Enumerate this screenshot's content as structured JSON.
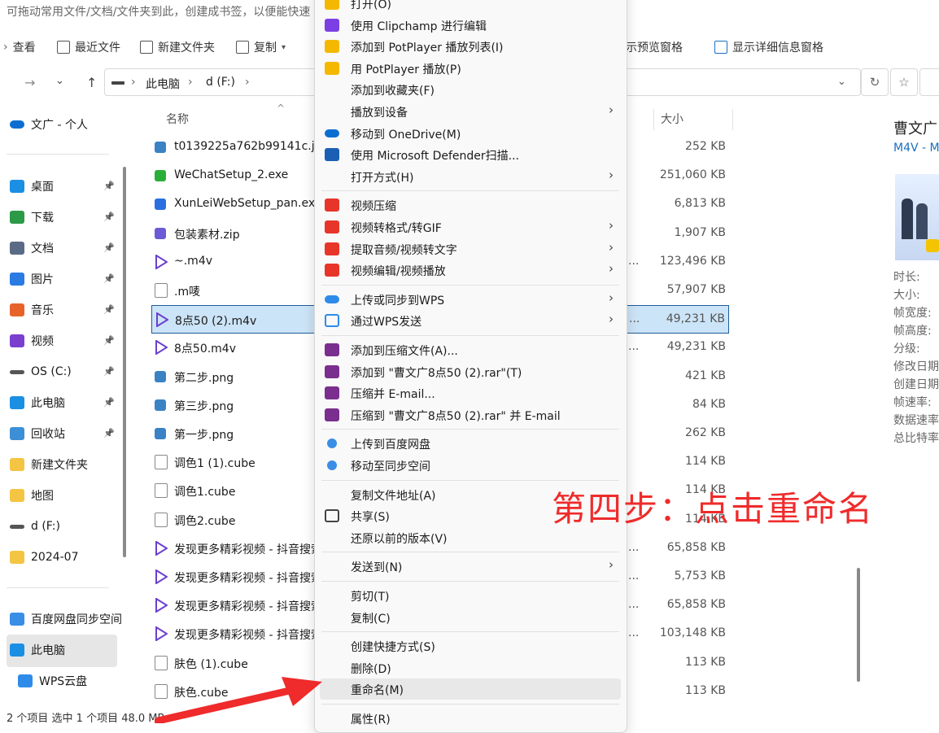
{
  "hint_text": "可拖动常用文件/文档/文件夹到此，创建成书签，以便能快速",
  "toolbar": {
    "view": "查看",
    "recent": "最近文件",
    "new_folder": "新建文件夹",
    "copy": "复制",
    "preview_pane": "示预览窗格",
    "details_pane": "显示详细信息窗格"
  },
  "address": {
    "crumbs": [
      "此电脑",
      "d (F:)"
    ]
  },
  "sidebar": {
    "account": "文广 - 个人",
    "items": [
      {
        "label": "桌面",
        "icon": "desktop-icon",
        "pinned": true
      },
      {
        "label": "下载",
        "icon": "download-icon",
        "pinned": true
      },
      {
        "label": "文档",
        "icon": "document-icon",
        "pinned": true
      },
      {
        "label": "图片",
        "icon": "pictures-icon",
        "pinned": true
      },
      {
        "label": "音乐",
        "icon": "music-icon",
        "pinned": true
      },
      {
        "label": "视频",
        "icon": "video-icon",
        "pinned": true
      },
      {
        "label": "OS (C:)",
        "icon": "drive-icon",
        "pinned": true
      },
      {
        "label": "此电脑",
        "icon": "computer-icon",
        "pinned": true
      },
      {
        "label": "回收站",
        "icon": "recycle-bin-icon",
        "pinned": true
      },
      {
        "label": "新建文件夹",
        "icon": "folder-icon",
        "pinned": false
      },
      {
        "label": "地图",
        "icon": "folder-icon",
        "pinned": false
      },
      {
        "label": "d (F:)",
        "icon": "drive-icon",
        "pinned": false
      },
      {
        "label": "2024-07",
        "icon": "folder-icon",
        "pinned": false
      }
    ],
    "bottom": [
      {
        "label": "百度网盘同步空间",
        "icon": "baidu-sync-icon"
      },
      {
        "label": "此电脑",
        "icon": "computer-icon"
      },
      {
        "label": "WPS云盘",
        "icon": "wps-cloud-icon"
      }
    ]
  },
  "columns": {
    "name": "名称",
    "size": "大小"
  },
  "files": [
    {
      "name": "t0139225a762b99141c.jpg",
      "size": "252 KB",
      "dots": false,
      "selected": false,
      "icon": "image-file-icon"
    },
    {
      "name": "WeChatSetup_2.exe",
      "size": "251,060 KB",
      "dots": false,
      "selected": false,
      "icon": "wechat-icon"
    },
    {
      "name": "XunLeiWebSetup_pan.exe",
      "size": "6,813 KB",
      "dots": false,
      "selected": false,
      "icon": "xunlei-icon"
    },
    {
      "name": "包装素材.zip",
      "size": "1,907 KB",
      "dots": false,
      "selected": false,
      "icon": "zip-file-icon"
    },
    {
      "name": "~.m4v",
      "size": "123,496 KB",
      "dots": true,
      "selected": false,
      "icon": "video-file-icon"
    },
    {
      "name": ".m唛",
      "size": "57,907 KB",
      "dots": false,
      "selected": false,
      "icon": "generic-file-icon"
    },
    {
      "name": "8点50 (2).m4v",
      "size": "49,231 KB",
      "dots": true,
      "selected": true,
      "icon": "video-file-icon"
    },
    {
      "name": "8点50.m4v",
      "size": "49,231 KB",
      "dots": true,
      "selected": false,
      "icon": "video-file-icon"
    },
    {
      "name": "第二步.png",
      "size": "421 KB",
      "dots": false,
      "selected": false,
      "icon": "image-file-icon"
    },
    {
      "name": "第三步.png",
      "size": "84 KB",
      "dots": false,
      "selected": false,
      "icon": "image-file-icon"
    },
    {
      "name": "第一步.png",
      "size": "262 KB",
      "dots": false,
      "selected": false,
      "icon": "image-file-icon"
    },
    {
      "name": "调色1 (1).cube",
      "size": "114 KB",
      "dots": false,
      "selected": false,
      "icon": "generic-file-icon"
    },
    {
      "name": "调色1.cube",
      "size": "114 KB",
      "dots": false,
      "selected": false,
      "icon": "generic-file-icon"
    },
    {
      "name": "调色2.cube",
      "size": "114 KB",
      "dots": false,
      "selected": false,
      "icon": "generic-file-icon"
    },
    {
      "name": "发现更多精彩视频 - 抖音搜索",
      "size": "65,858 KB",
      "dots": true,
      "selected": false,
      "icon": "video-file-icon"
    },
    {
      "name": "发现更多精彩视频 - 抖音搜索",
      "size": "5,753 KB",
      "dots": true,
      "selected": false,
      "icon": "video-file-icon"
    },
    {
      "name": "发现更多精彩视频 - 抖音搜索",
      "size": "65,858 KB",
      "dots": true,
      "selected": false,
      "icon": "video-file-icon"
    },
    {
      "name": "发现更多精彩视频 - 抖音搜索",
      "size": "103,148 KB",
      "dots": true,
      "selected": false,
      "icon": "video-file-icon"
    },
    {
      "name": "肤色 (1).cube",
      "size": "113 KB",
      "dots": false,
      "selected": false,
      "icon": "generic-file-icon"
    },
    {
      "name": "肤色.cube",
      "size": "113 KB",
      "dots": false,
      "selected": false,
      "icon": "generic-file-icon"
    }
  ],
  "details": {
    "title": "曹文广",
    "subtitle": "M4V - M",
    "props": [
      "时长:",
      "大小:",
      "帧宽度:",
      "帧高度:",
      "分级:",
      "修改日期",
      "创建日期",
      "帧速率:",
      "数据速率",
      "总比特率"
    ]
  },
  "status": "2 个项目    选中 1 个项目  48.0 MB",
  "context_menu": [
    {
      "label": "打开(O)",
      "icon": "potplayer-icon",
      "color": "#f5b800",
      "arrow": false
    },
    {
      "label": "使用 Clipchamp 进行编辑",
      "icon": "clipchamp-icon",
      "color": "#7b3fe4",
      "arrow": false
    },
    {
      "label": "添加到 PotPlayer 播放列表(I)",
      "icon": "potplayer-icon",
      "color": "#f5b800",
      "arrow": false
    },
    {
      "label": "用 PotPlayer 播放(P)",
      "icon": "potplayer-icon",
      "color": "#f5b800",
      "arrow": false
    },
    {
      "label": "添加到收藏夹(F)",
      "icon": "",
      "color": "",
      "arrow": false
    },
    {
      "label": "播放到设备",
      "icon": "",
      "color": "",
      "arrow": true
    },
    {
      "label": "移动到 OneDrive(M)",
      "icon": "onedrive-icon",
      "color": "#0a6ed1",
      "arrow": false
    },
    {
      "label": "使用 Microsoft Defender扫描...",
      "icon": "defender-icon",
      "color": "#1a5fb4",
      "arrow": false
    },
    {
      "label": "打开方式(H)",
      "icon": "",
      "color": "",
      "arrow": true
    },
    {
      "sep": true
    },
    {
      "label": "视频压缩",
      "icon": "wps-icon",
      "color": "#e8352a",
      "arrow": false
    },
    {
      "label": "视频转格式/转GIF",
      "icon": "wps-icon",
      "color": "#e8352a",
      "arrow": true
    },
    {
      "label": "提取音频/视频转文字",
      "icon": "wps-icon",
      "color": "#e8352a",
      "arrow": true
    },
    {
      "label": "视频编辑/视频播放",
      "icon": "wps-icon",
      "color": "#e8352a",
      "arrow": true
    },
    {
      "sep": true
    },
    {
      "label": "上传或同步到WPS",
      "icon": "wps-cloud-icon",
      "color": "#2f8bea",
      "arrow": true
    },
    {
      "label": "通过WPS发送",
      "icon": "share-icon",
      "color": "#2f8bea",
      "arrow": true
    },
    {
      "sep": true
    },
    {
      "label": "添加到压缩文件(A)...",
      "icon": "winrar-icon",
      "color": "#7a2f8e",
      "arrow": false
    },
    {
      "label": "添加到 \"曹文广8点50 (2).rar\"(T)",
      "icon": "winrar-icon",
      "color": "#7a2f8e",
      "arrow": false
    },
    {
      "label": "压缩并 E-mail...",
      "icon": "winrar-icon",
      "color": "#7a2f8e",
      "arrow": false
    },
    {
      "label": "压缩到 \"曹文广8点50 (2).rar\" 并 E-mail",
      "icon": "winrar-icon",
      "color": "#7a2f8e",
      "arrow": false
    },
    {
      "sep": true
    },
    {
      "label": "上传到百度网盘",
      "icon": "baidu-icon",
      "color": "#3a8ee6",
      "arrow": false
    },
    {
      "label": "移动至同步空间",
      "icon": "baidu-icon",
      "color": "#3a8ee6",
      "arrow": false
    },
    {
      "sep": true
    },
    {
      "label": "复制文件地址(A)",
      "icon": "",
      "color": "",
      "arrow": false
    },
    {
      "label": "共享(S)",
      "icon": "share-icon",
      "color": "#444444",
      "arrow": false
    },
    {
      "label": "还原以前的版本(V)",
      "icon": "",
      "color": "",
      "arrow": false
    },
    {
      "sep": true
    },
    {
      "label": "发送到(N)",
      "icon": "",
      "color": "",
      "arrow": true
    },
    {
      "sep": true
    },
    {
      "label": "剪切(T)",
      "icon": "",
      "color": "",
      "arrow": false
    },
    {
      "label": "复制(C)",
      "icon": "",
      "color": "",
      "arrow": false
    },
    {
      "sep": true
    },
    {
      "label": "创建快捷方式(S)",
      "icon": "",
      "color": "",
      "arrow": false
    },
    {
      "label": "删除(D)",
      "icon": "",
      "color": "",
      "arrow": false
    },
    {
      "label": "重命名(M)",
      "icon": "",
      "color": "",
      "arrow": false,
      "hover": true
    },
    {
      "sep": true
    },
    {
      "label": "属性(R)",
      "icon": "",
      "color": "",
      "arrow": false
    }
  ],
  "annotation": "第四步：点击重命名",
  "colors": {
    "accent": "#0067c0",
    "annotation": "#ef2b2b",
    "selection": "#cce4f7"
  }
}
